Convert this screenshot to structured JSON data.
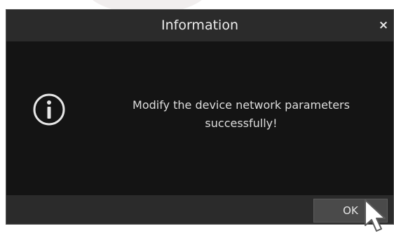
{
  "dialog": {
    "title": "Information",
    "close_glyph": "×",
    "message_line1": "Modify the device network parameters",
    "message_line2": "successfully!",
    "ok_label": "OK",
    "icon": "info-circle-icon"
  },
  "colors": {
    "titlebar": "#2b2b2b",
    "body": "#141414",
    "button": "#4a4a4a",
    "text": "#dddddd"
  }
}
